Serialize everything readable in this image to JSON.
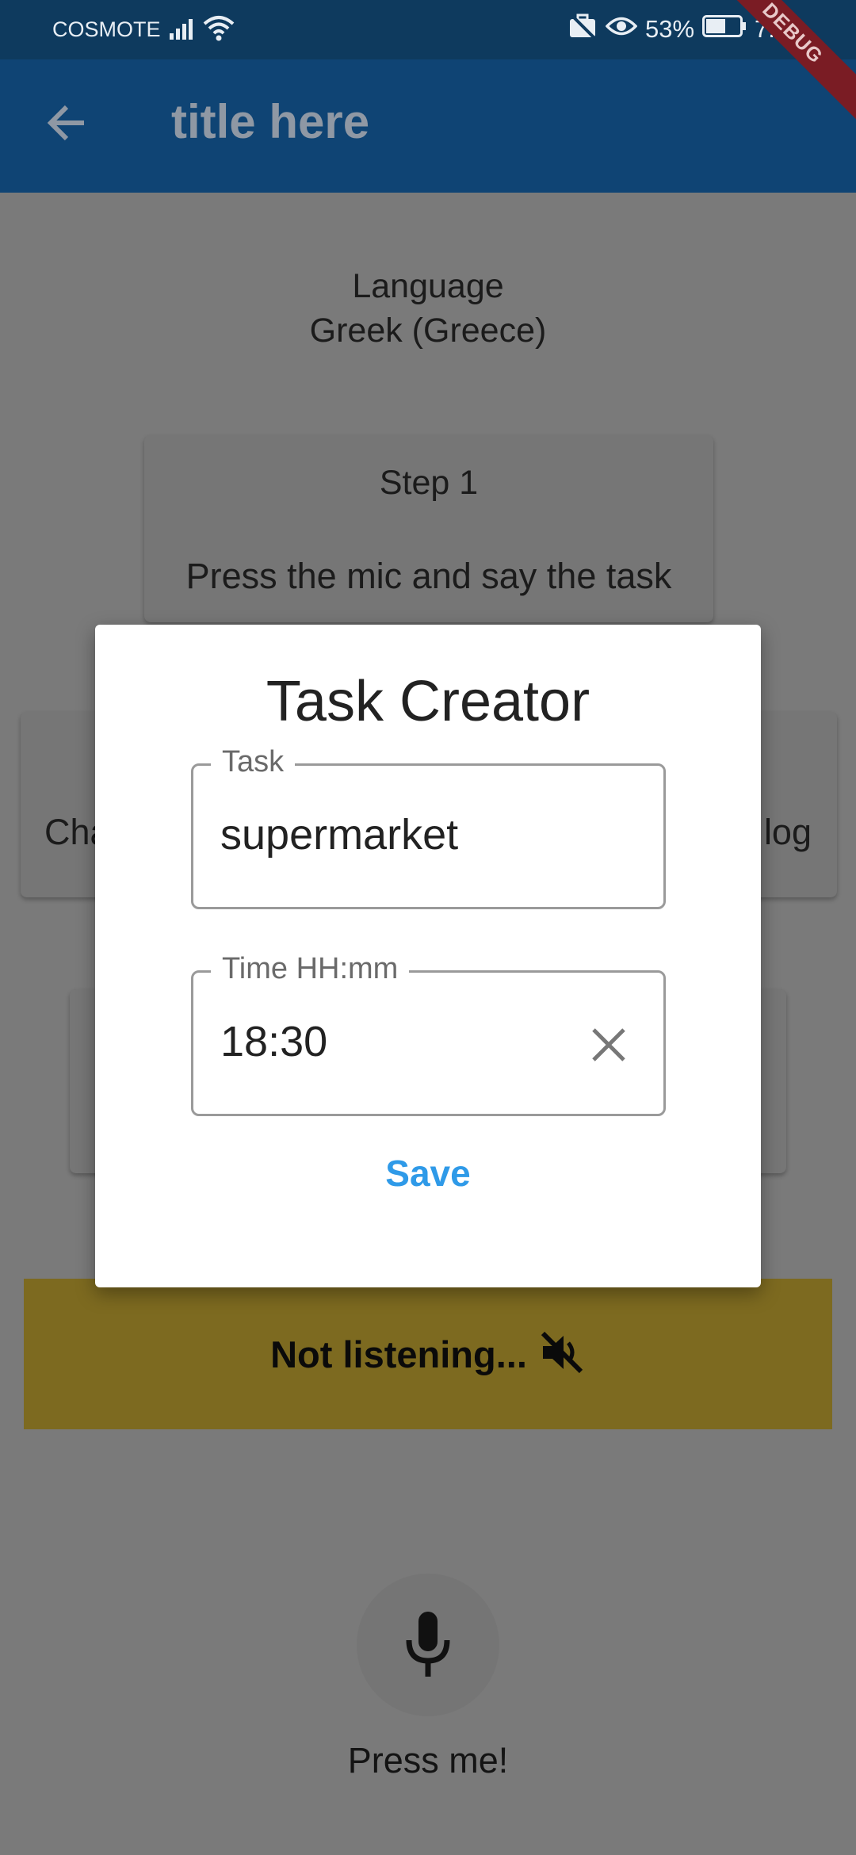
{
  "status_bar": {
    "carrier": "COSMOTE",
    "battery_percent": "53%",
    "time": "7:16",
    "icons": [
      "signal-icon",
      "wifi-icon",
      "work-profile-icon",
      "eye-icon",
      "battery-icon"
    ]
  },
  "app_bar": {
    "title": "title here",
    "back_icon": "arrow-back-icon",
    "color": "#0f4474"
  },
  "debug_banner": "DEBUG",
  "main": {
    "language_label": "Language",
    "language_value": "Greek (Greece)",
    "step_title": "Step 1",
    "step_instruction": "Press the mic and say the task",
    "left_card_text": "Cha",
    "right_card_text": "log",
    "listening_status": "Not listening...",
    "listening_icon": "volume-off-icon",
    "listening_bar_color": "#e8c33a",
    "mic_icon": "mic-icon",
    "press_label": "Press me!"
  },
  "dialog": {
    "title": "Task Creator",
    "task_field": {
      "label": "Task",
      "value": "supermarket"
    },
    "time_field": {
      "label": "Time  HH:mm",
      "value": "18:30",
      "clear_icon": "close-icon"
    },
    "save_label": "Save",
    "accent_color": "#2f9ae8"
  }
}
